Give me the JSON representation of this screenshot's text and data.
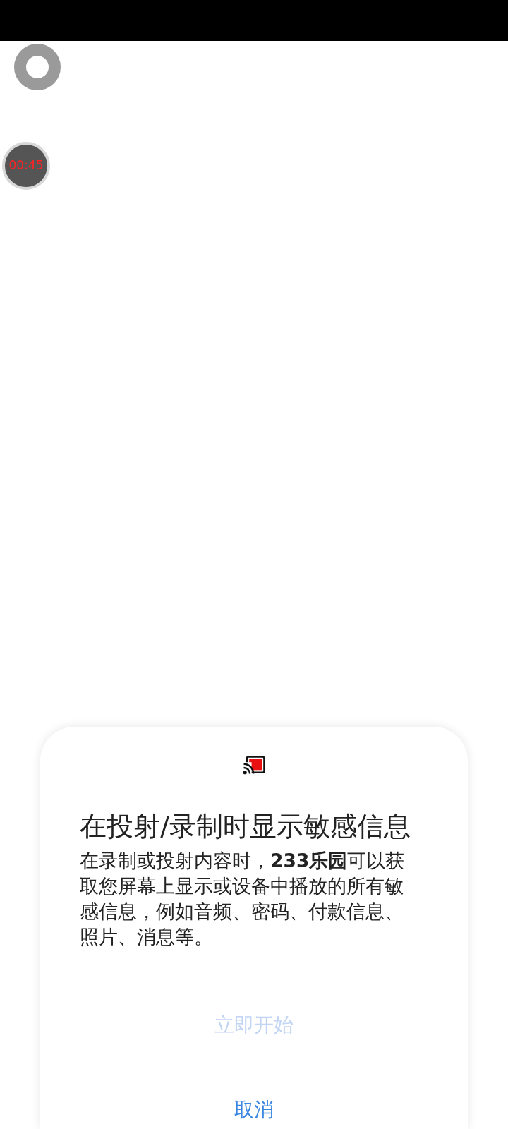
{
  "floating_buttons": [
    {
      "kind": "ring"
    },
    {
      "kind": "timer",
      "label": "00:45"
    }
  ],
  "dialog": {
    "title": "在投射/录制时显示敏感信息",
    "message": "在录制或投射内容时，**233乐园**可以获取您屏幕上显示或设备中播放的所有敏感信息，例如音频、密码、付款信息、照片、消息等。",
    "buttons": [
      {
        "label": "立即开始",
        "disabled": true
      },
      {
        "label": "取消",
        "disabled": false
      }
    ]
  }
}
